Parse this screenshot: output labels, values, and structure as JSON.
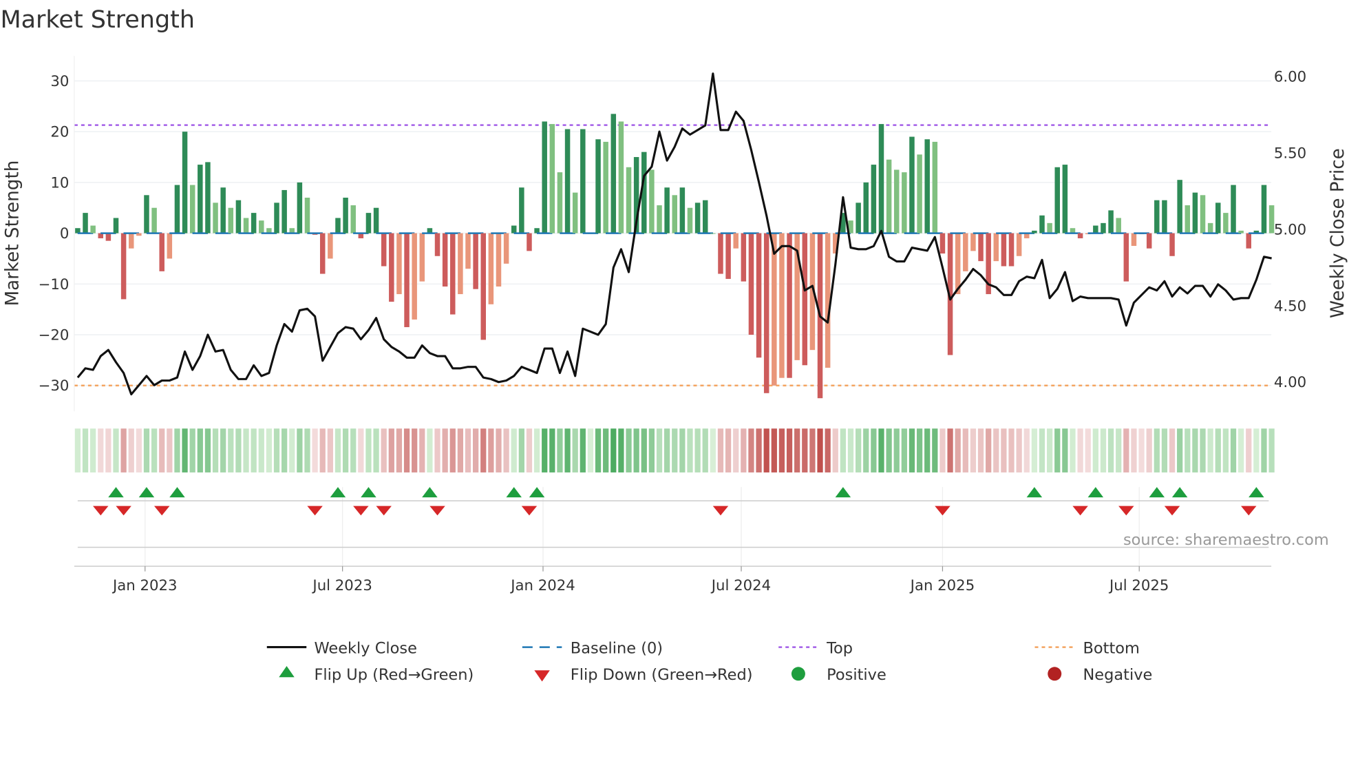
{
  "chart_data": {
    "type": "bar",
    "title": "Market Strength",
    "ylabel": "Market Strength",
    "y2label": "Weekly Close Price",
    "ylim": [
      -35,
      35
    ],
    "y2lim": [
      3.85,
      6.1
    ],
    "yticks": [
      "30",
      "20",
      "10",
      "0",
      "−10",
      "−20",
      "−30"
    ],
    "ytick_values": [
      30,
      20,
      10,
      0,
      -10,
      -20,
      -30
    ],
    "y2ticks": [
      "4.00",
      "4.50",
      "5.00",
      "5.50",
      "6.00"
    ],
    "y2tick_values": [
      4.0,
      4.5,
      5.0,
      5.5,
      6.0
    ],
    "xticks": [
      {
        "label": "Jan 2023",
        "week": 8.8
      },
      {
        "label": "Jul 2023",
        "week": 34.6
      },
      {
        "label": "Jan 2024",
        "week": 60.8
      },
      {
        "label": "Jul 2024",
        "week": 86.7
      },
      {
        "label": "Jan 2025",
        "week": 113.0
      },
      {
        "label": "Jul 2025",
        "week": 138.7
      }
    ],
    "top_level": 21.3,
    "bottom_level": -30,
    "strength": [
      1,
      4,
      1.5,
      -1,
      -1.5,
      3,
      -13,
      -3,
      -0.5,
      7.5,
      5,
      -7.5,
      -5,
      9.5,
      20,
      9.5,
      13.5,
      14,
      6,
      9,
      5,
      6.5,
      3,
      4,
      2.5,
      1,
      6,
      8.5,
      1,
      10,
      7,
      -0.3,
      -8,
      -5,
      3,
      7,
      5.5,
      -1,
      4,
      5,
      -6.5,
      -13.5,
      -12,
      -18.5,
      -17,
      -9.5,
      1,
      -4.5,
      -10.5,
      -16,
      -12,
      -7,
      -11,
      -21,
      -14,
      -10.5,
      -6,
      1.5,
      9,
      -3.5,
      1,
      22,
      21.5,
      12,
      20.5,
      8,
      20.5,
      0,
      18.5,
      18,
      23.5,
      22,
      13,
      15,
      16,
      12.5,
      5.5,
      9,
      7.5,
      9,
      5,
      6,
      6.5,
      0,
      -8,
      -9,
      -3,
      -9.5,
      -20,
      -24.5,
      -31.5,
      -30,
      -28.5,
      -28.5,
      -25,
      -26,
      -23,
      -32.5,
      -26.5,
      -4,
      4,
      2.5,
      6,
      10,
      13.5,
      21.5,
      14.5,
      12.5,
      12,
      19,
      15.5,
      18.5,
      18,
      -4,
      -24,
      -12,
      -7.5,
      -3.5,
      -5.5,
      -12,
      -5.5,
      -6.5,
      -6.5,
      -4.5,
      -1,
      0.5,
      3.5,
      2,
      13,
      13.5,
      1,
      -1,
      -0.2,
      1.5,
      2,
      4.5,
      3,
      -9.5,
      -2.5,
      -0.2,
      -3,
      6.5,
      6.5,
      -4.5,
      10.5,
      5.5,
      8,
      7.5,
      2,
      6,
      4,
      9.5,
      0.5,
      -3,
      0.5,
      9.5,
      5.5
    ],
    "weekly_close": [
      4.03,
      4.09,
      4.08,
      4.17,
      4.21,
      4.13,
      4.06,
      3.92,
      3.98,
      4.04,
      3.98,
      4.01,
      4.01,
      4.03,
      4.2,
      4.08,
      4.17,
      4.31,
      4.2,
      4.21,
      4.08,
      4.02,
      4.02,
      4.11,
      4.04,
      4.06,
      4.24,
      4.38,
      4.33,
      4.47,
      4.48,
      4.43,
      4.14,
      4.23,
      4.32,
      4.36,
      4.35,
      4.28,
      4.34,
      4.42,
      4.28,
      4.23,
      4.2,
      4.16,
      4.16,
      4.24,
      4.19,
      4.17,
      4.17,
      4.09,
      4.09,
      4.1,
      4.1,
      4.03,
      4.02,
      4.0,
      4.01,
      4.04,
      4.1,
      4.08,
      4.06,
      4.22,
      4.22,
      4.06,
      4.2,
      4.04,
      4.35,
      4.33,
      4.31,
      4.38,
      4.75,
      4.87,
      4.72,
      5.05,
      5.35,
      5.41,
      5.64,
      5.45,
      5.54,
      5.66,
      5.62,
      5.65,
      5.68,
      6.02,
      5.65,
      5.65,
      5.77,
      5.71,
      5.52,
      5.31,
      5.09,
      4.84,
      4.89,
      4.89,
      4.86,
      4.6,
      4.63,
      4.43,
      4.39,
      4.77,
      5.21,
      4.88,
      4.87,
      4.87,
      4.89,
      4.99,
      4.82,
      4.79,
      4.79,
      4.88,
      4.87,
      4.86,
      4.95,
      4.75,
      4.54,
      4.61,
      4.67,
      4.74,
      4.7,
      4.64,
      4.62,
      4.57,
      4.57,
      4.66,
      4.69,
      4.68,
      4.8,
      4.55,
      4.61,
      4.72,
      4.53,
      4.56,
      4.55,
      4.55,
      4.55,
      4.55,
      4.54,
      4.37,
      4.52,
      4.57,
      4.62,
      4.6,
      4.66,
      4.56,
      4.62,
      4.58,
      4.63,
      4.63,
      4.56,
      4.64,
      4.6,
      4.54,
      4.55,
      4.55,
      4.67,
      4.82,
      4.81
    ],
    "flip_up_weeks": [
      5,
      9,
      13,
      34,
      38,
      46,
      57,
      60,
      100,
      125,
      133,
      141,
      144,
      154
    ],
    "flip_down_weeks": [
      3,
      6,
      11,
      31,
      37,
      40,
      47,
      59,
      84,
      113,
      131,
      137,
      143,
      153
    ],
    "legend": {
      "weekly_close": "Weekly Close",
      "baseline": "Baseline (0)",
      "top": "Top",
      "bottom": "Bottom",
      "flip_up": "Flip Up (Red→Green)",
      "flip_down": "Flip Down (Green→Red)",
      "positive": "Positive",
      "negative": "Negative"
    },
    "legend_placement": "bottom",
    "source": "source: sharemaestro.com",
    "colors": {
      "pos_strong": "#2e8b57",
      "pos_weak": "#80c080",
      "neg_strong": "#cd5c5c",
      "neg_weak": "#e9967a",
      "baseline": "#1f77b4",
      "top": "#a35ee8",
      "bottom": "#f4a460",
      "close": "#111111",
      "flip_up": "#1e9e3e",
      "flip_down": "#d62728",
      "positive": "#1e9e3e",
      "negative": "#b22222"
    }
  }
}
